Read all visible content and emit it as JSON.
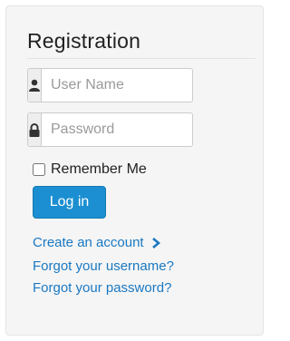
{
  "form": {
    "title": "Registration",
    "username": {
      "placeholder": "User Name",
      "value": ""
    },
    "password": {
      "placeholder": "Password",
      "value": ""
    },
    "remember_label": "Remember Me",
    "remember_checked": false,
    "login_label": "Log in"
  },
  "links": {
    "create_account": "Create an account",
    "forgot_username": "Forgot your username?",
    "forgot_password": "Forgot your password?"
  },
  "icons": {
    "username": "user-icon",
    "password": "lock-icon",
    "create_account": "chevron-right-icon"
  },
  "colors": {
    "primary_button": "#1b8fd1",
    "link": "#1a78c2",
    "panel_background": "#f5f5f5"
  }
}
